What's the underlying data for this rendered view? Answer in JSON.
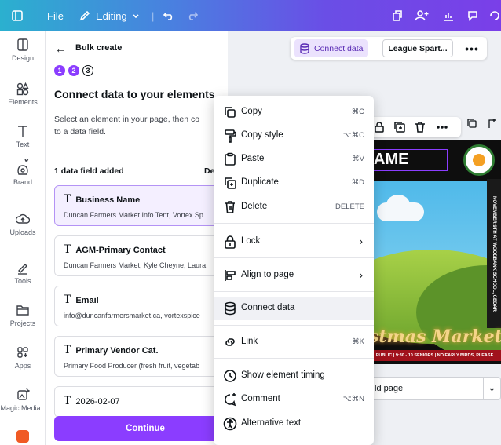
{
  "topbar": {
    "file_label": "File",
    "editing_label": "Editing",
    "colors": {
      "gradient_start": "#2bb0cf",
      "gradient_end": "#7a3fe8"
    }
  },
  "rail": {
    "items": [
      {
        "label": "Design",
        "icon": "design-icon"
      },
      {
        "label": "Elements",
        "icon": "elements-icon"
      },
      {
        "label": "Text",
        "icon": "text-icon"
      },
      {
        "label": "Brand",
        "icon": "brand-icon"
      },
      {
        "label": "Uploads",
        "icon": "uploads-icon"
      },
      {
        "label": "Tools",
        "icon": "tools-icon"
      },
      {
        "label": "Projects",
        "icon": "folder-icon"
      },
      {
        "label": "Apps",
        "icon": "apps-icon"
      },
      {
        "label": "Magic Media",
        "icon": "magic-media-icon"
      }
    ]
  },
  "panel": {
    "title": "Bulk create",
    "steps": [
      "1",
      "2",
      "3"
    ],
    "heading": "Connect data to your elements",
    "description_line1": "Select an element in your page, then co",
    "description_line2": "to a data field.",
    "count_label": "1 data field added",
    "count_right": "De",
    "fields": [
      {
        "name": "Business Name",
        "value": "Duncan Farmers Market Info Tent, Vortex Sp"
      },
      {
        "name": "AGM-Primary Contact",
        "value": "Duncan Farmers Market, Kyle Cheyne, Laura"
      },
      {
        "name": "Email",
        "value": "info@duncanfarmersmarket.ca, vortexspice"
      },
      {
        "name": "Primary Vendor Cat.",
        "value": "Primary Food Producer (fresh fruit, vegetab"
      },
      {
        "name": "2026-02-07",
        "value": ""
      }
    ],
    "continue_label": "Continue",
    "accent": "#8b3dff"
  },
  "canvas_toolbar": {
    "connect_label": "Connect data",
    "league_label": "League Spart...",
    "more_label": "•••"
  },
  "poster": {
    "name_text": "AME",
    "side_text": "NOVEMBER 9TH AT WOODBANK SCHOOL, CEDAR",
    "market_text": "stmas Market",
    "banner_text": "AL PUBLIC | 9:30 - 10 SENIORS | NO EARLY BIRDS, PLEASE."
  },
  "page_select": {
    "value": "ld page"
  },
  "context_menu": {
    "items": [
      {
        "label": "Copy",
        "shortcut": "⌘C",
        "icon": "copy-icon"
      },
      {
        "label": "Copy style",
        "shortcut": "⌥⌘C",
        "icon": "paint-roller-icon"
      },
      {
        "label": "Paste",
        "shortcut": "⌘V",
        "icon": "clipboard-icon"
      },
      {
        "label": "Duplicate",
        "shortcut": "⌘D",
        "icon": "duplicate-icon"
      },
      {
        "label": "Delete",
        "shortcut": "DELETE",
        "icon": "trash-icon"
      },
      {
        "label": "Lock",
        "shortcut": "›",
        "icon": "lock-icon"
      },
      {
        "label": "Align to page",
        "shortcut": "›",
        "icon": "align-icon"
      },
      {
        "label": "Connect data",
        "shortcut": "",
        "icon": "database-icon"
      },
      {
        "label": "Link",
        "shortcut": "⌘K",
        "icon": "link-icon"
      },
      {
        "label": "Show element timing",
        "shortcut": "",
        "icon": "timer-icon"
      },
      {
        "label": "Comment",
        "shortcut": "⌥⌘N",
        "icon": "comment-icon"
      },
      {
        "label": "Alternative text",
        "shortcut": "",
        "icon": "accessibility-icon"
      }
    ]
  }
}
